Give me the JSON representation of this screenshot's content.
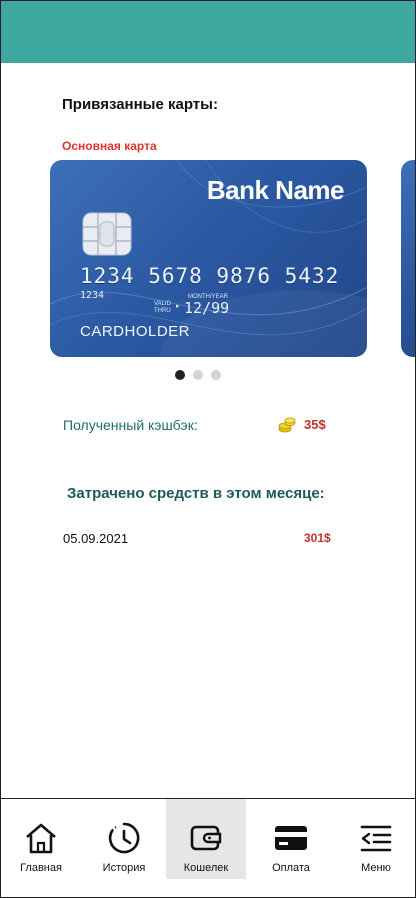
{
  "linked_cards": {
    "title": "Привязанные карты:",
    "main_card_label": "Основная карта",
    "card": {
      "bank_name": "Bank Name",
      "number": "1234 5678 9876 5432",
      "number_small": "1234",
      "valid_thru_label": "VALID\nTHRU",
      "month_year_label": "MONTH/YEAR",
      "expiry": "12/99",
      "holder": "CARDHOLDER"
    },
    "carousel": {
      "total": 3,
      "active_index": 0
    }
  },
  "cashback": {
    "label": "Полученный кэшбэк:",
    "value": "35$",
    "icon": "coins-icon"
  },
  "spending": {
    "title": "Затрачено средств в этом месяце:",
    "transactions": [
      {
        "date": "05.09.2021",
        "amount": "301$"
      }
    ]
  },
  "colors": {
    "header": "#3ea7a0",
    "accent_red": "#c0302e",
    "teal_text": "#1f6b6b",
    "card_blue": "#2b5aa3"
  },
  "nav": {
    "items": [
      {
        "label": "Главная",
        "icon": "home-icon",
        "active": false
      },
      {
        "label": "История",
        "icon": "history-clock-icon",
        "active": false
      },
      {
        "label": "Кошелек",
        "icon": "wallet-icon",
        "active": true
      },
      {
        "label": "Оплата",
        "icon": "credit-card-icon",
        "active": false
      },
      {
        "label": "Меню",
        "icon": "menu-icon",
        "active": false
      }
    ]
  }
}
